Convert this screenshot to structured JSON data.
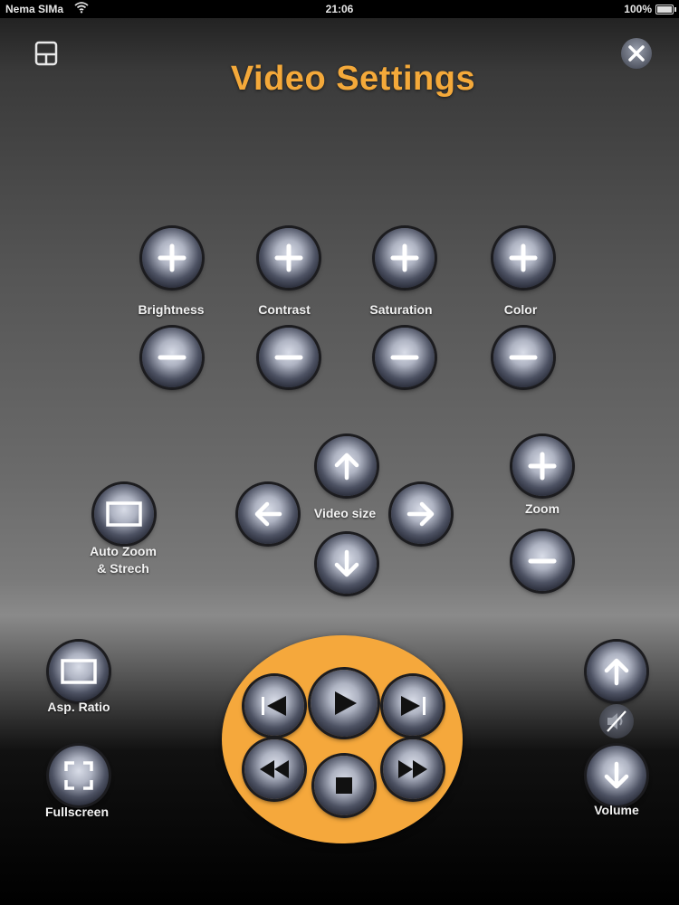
{
  "status_bar": {
    "carrier": "Nema SIMa",
    "time": "21:06",
    "battery": "100%",
    "battery_level": 1.0
  },
  "header": {
    "title": "Video Settings",
    "left_icon": "window-layout-icon",
    "close_icon": "close-icon"
  },
  "adjustments": [
    {
      "label": "Brightness"
    },
    {
      "label": "Contrast"
    },
    {
      "label": "Saturation"
    },
    {
      "label": "Color"
    }
  ],
  "video_size": {
    "label": "Video size"
  },
  "zoom": {
    "label": "Zoom"
  },
  "auto_zoom": {
    "label_line1": "Auto Zoom",
    "label_line2": "& Strech"
  },
  "aspect_ratio": {
    "label": "Asp. Ratio"
  },
  "fullscreen": {
    "label": "Fullscreen"
  },
  "volume": {
    "label": "Volume",
    "mute_icon": "mute-icon"
  },
  "playback": [
    "previous-track",
    "play",
    "next-track",
    "rewind",
    "stop",
    "fast-forward"
  ],
  "colors": {
    "accent": "#f4a93a",
    "pad": "#f5a83c"
  }
}
